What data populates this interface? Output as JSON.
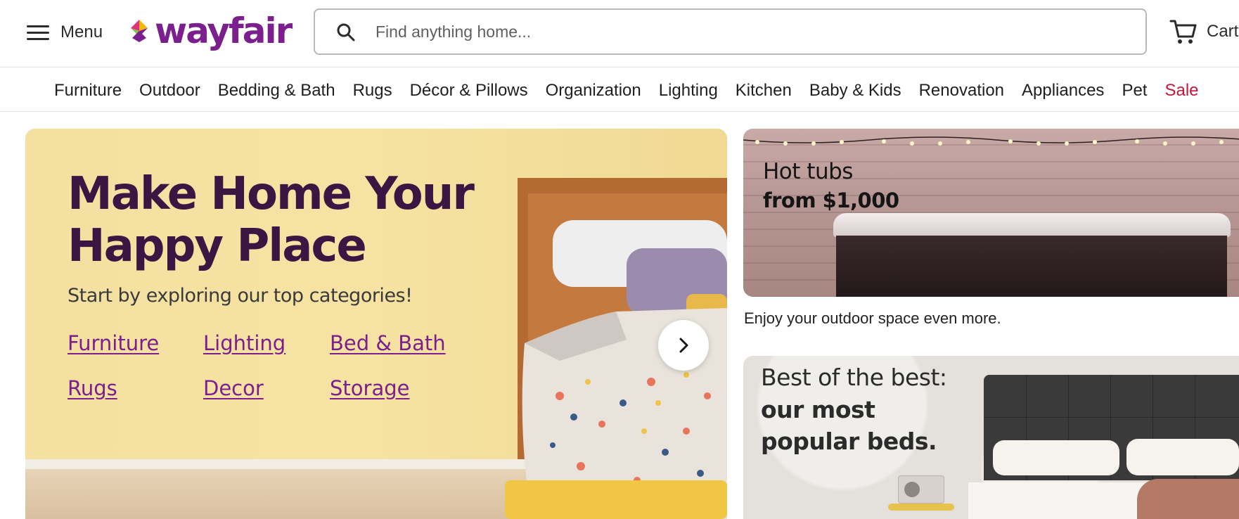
{
  "header": {
    "menu_label": "Menu",
    "logo_text": "wayfair",
    "search_placeholder": "Find anything home...",
    "cart_label": "Cart"
  },
  "nav": {
    "categories": [
      "Furniture",
      "Outdoor",
      "Bedding & Bath",
      "Rugs",
      "Décor & Pillows",
      "Organization",
      "Lighting",
      "Kitchen",
      "Baby & Kids",
      "Renovation",
      "Appliances",
      "Pet",
      "Sale"
    ]
  },
  "hero": {
    "title": "Make Home Your Happy Place",
    "subtitle": "Start by exploring our top categories!",
    "links": [
      "Furniture",
      "Lighting",
      "Bed & Bath",
      "Rugs",
      "Decor",
      "Storage"
    ]
  },
  "promo_hot_tubs": {
    "title": "Hot tubs",
    "price": "from $1,000",
    "caption": "Enjoy your outdoor space even more."
  },
  "promo_beds": {
    "title": "Best of the best:",
    "subtitle": "our most popular beds."
  },
  "colors": {
    "brand_purple": "#7b1f8e",
    "hero_title": "#3b1642",
    "sale_red": "#c4183c",
    "hero_background": "#f4df99"
  },
  "icons": {
    "menu": "hamburger-icon",
    "search": "search-icon",
    "cart": "cart-icon",
    "carousel_next": "chevron-right-icon"
  }
}
